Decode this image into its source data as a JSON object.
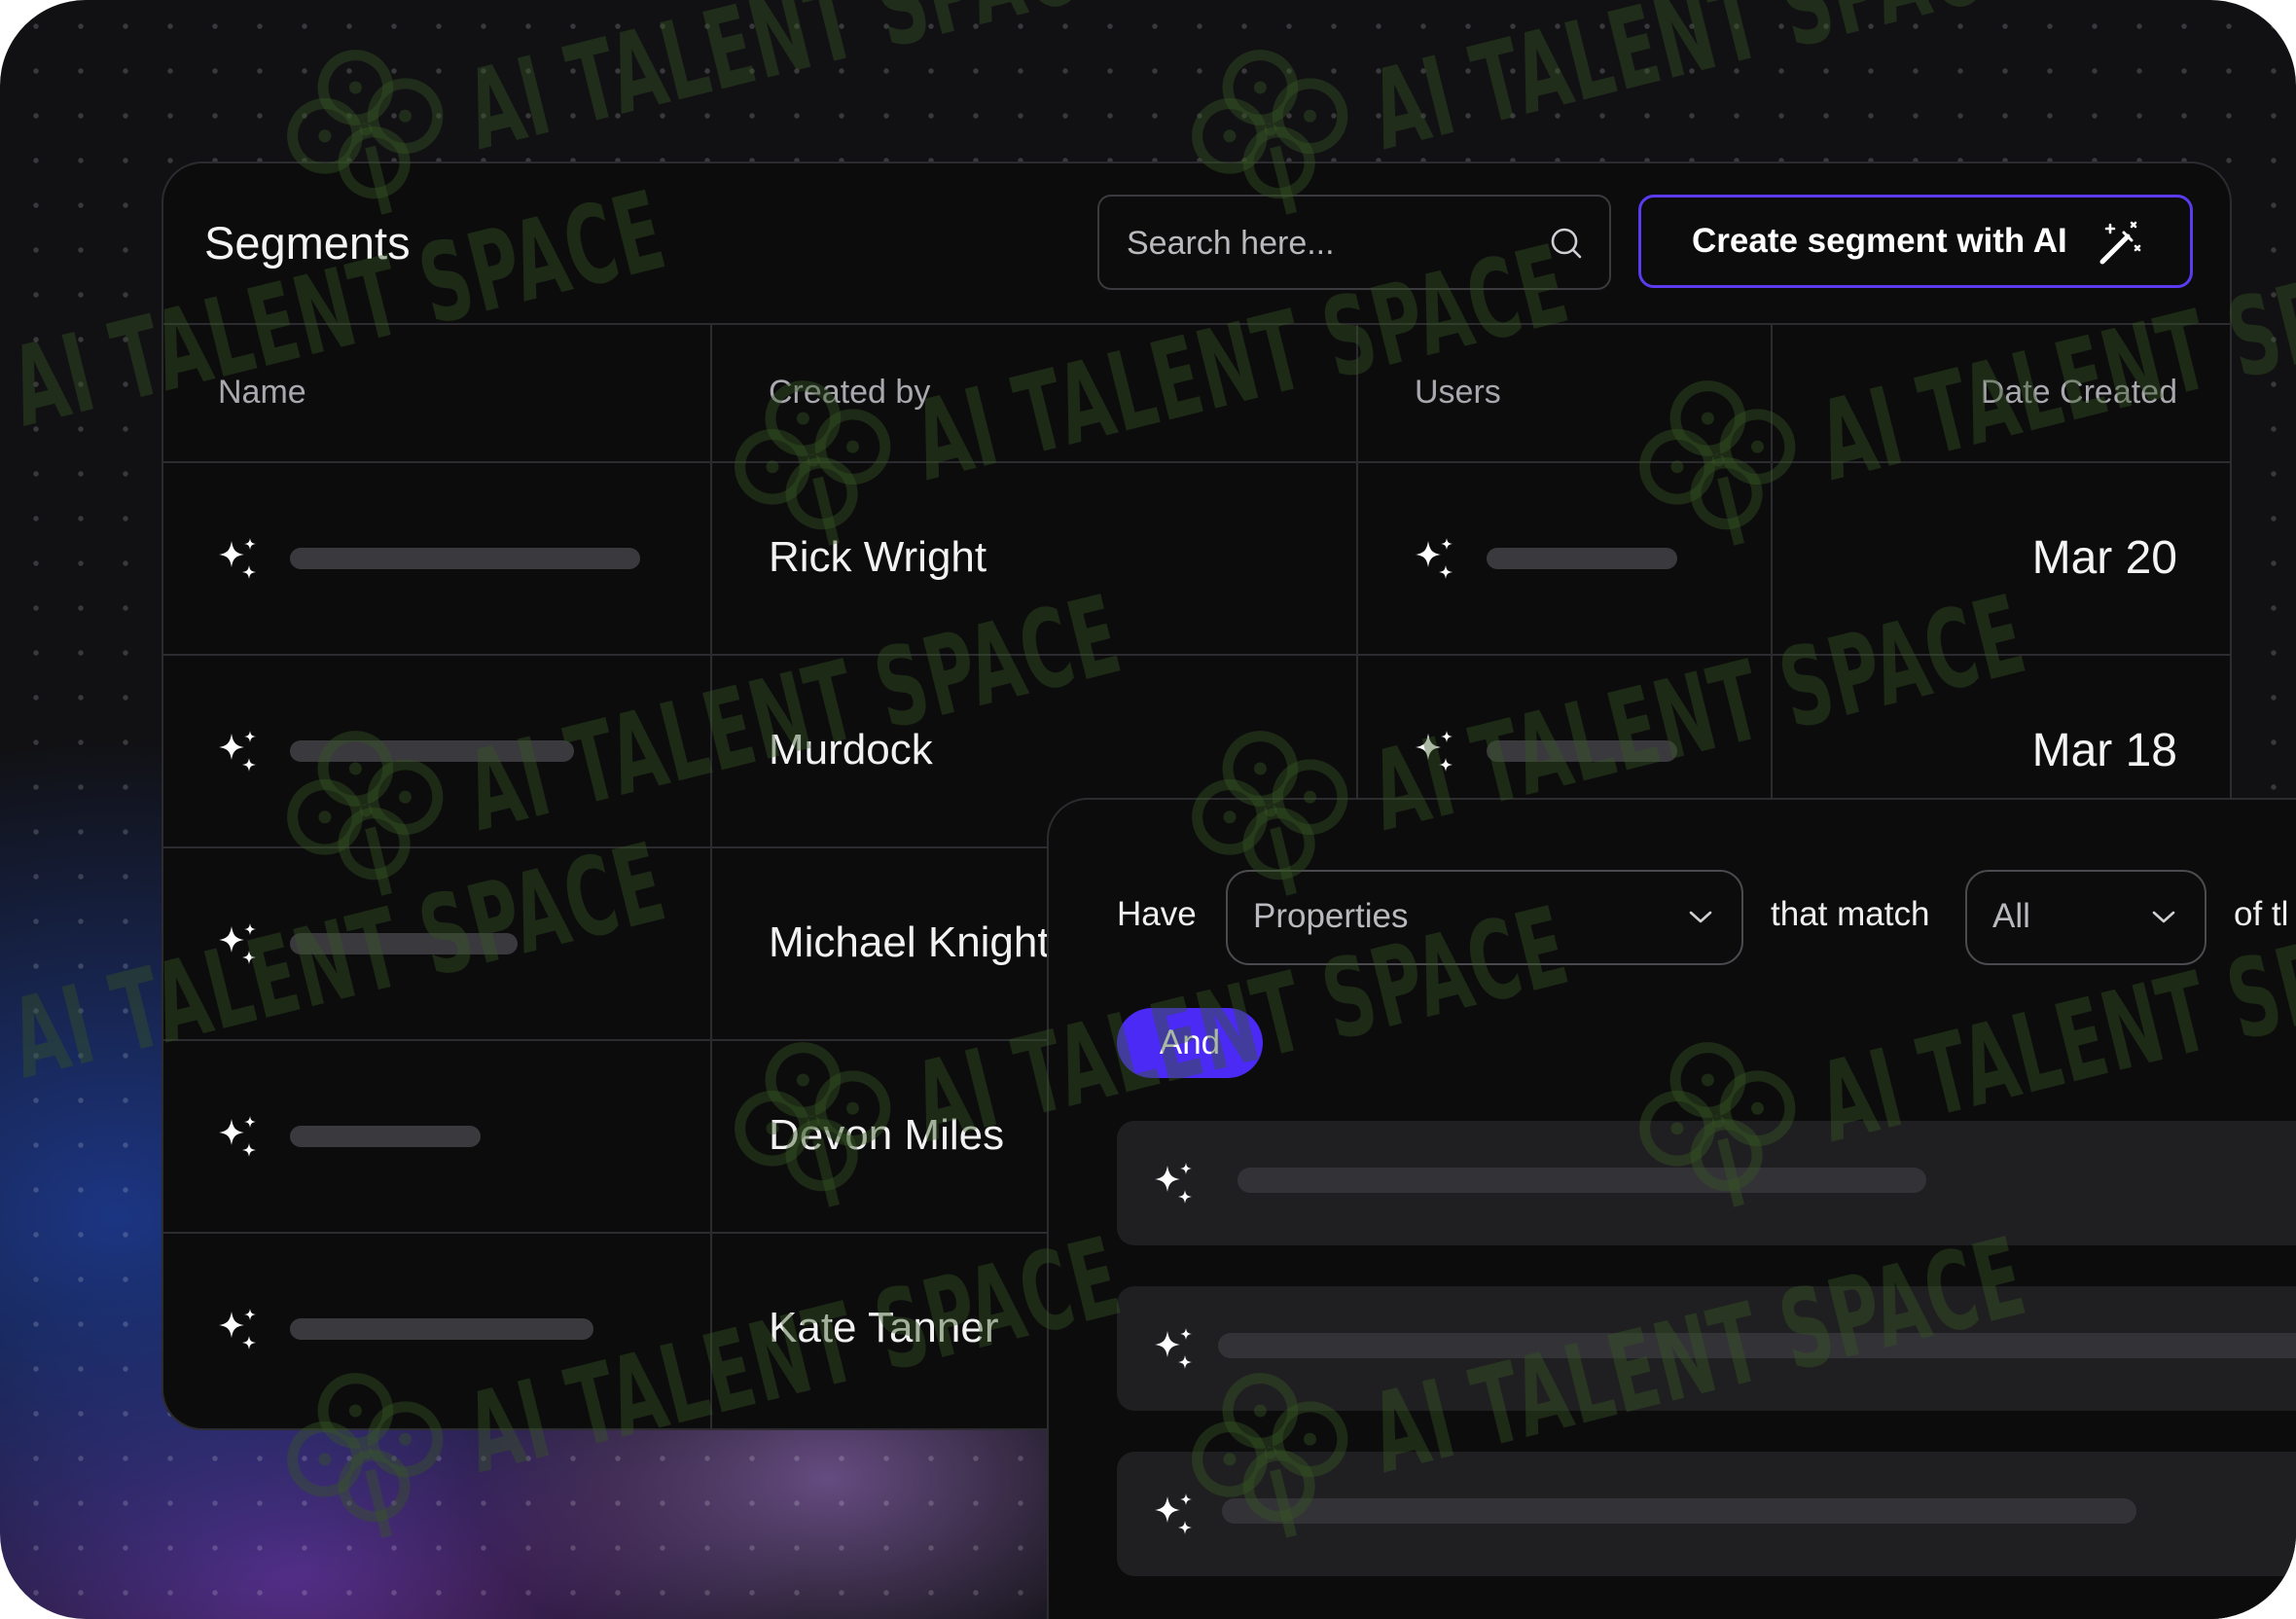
{
  "header": {
    "title": "Segments",
    "search": {
      "placeholder": "Search here...",
      "value": ""
    },
    "create_button_label": "Create segment with AI"
  },
  "table": {
    "columns": [
      "Name",
      "Created by",
      "Users",
      "Date Created"
    ],
    "rows": [
      {
        "created_by": "Rick Wright",
        "date_created": "Mar 20"
      },
      {
        "created_by": "Murdock",
        "date_created": "Mar 18"
      },
      {
        "created_by": "Michael Knight",
        "date_created": ""
      },
      {
        "created_by": "Devon Miles",
        "date_created": ""
      },
      {
        "created_by": "Kate Tanner",
        "date_created": ""
      }
    ]
  },
  "filter": {
    "have_label": "Have",
    "properties_select": "Properties",
    "match_label": "that match",
    "match_select": "All",
    "trailing_label": "of tl",
    "and_pill": "And"
  },
  "watermark": {
    "text": "AI TALENT SPACE"
  },
  "colors": {
    "accent": "#4b2af5",
    "cta_border": "#5b3bf0",
    "card_bg": "#0c0c0d",
    "placeholder_bar": "#3a3a3e"
  },
  "icons": {
    "row_icon": "sparkles-icon",
    "search": "search-icon",
    "cta": "magic-wand-icon",
    "select": "chevron-down-icon"
  }
}
